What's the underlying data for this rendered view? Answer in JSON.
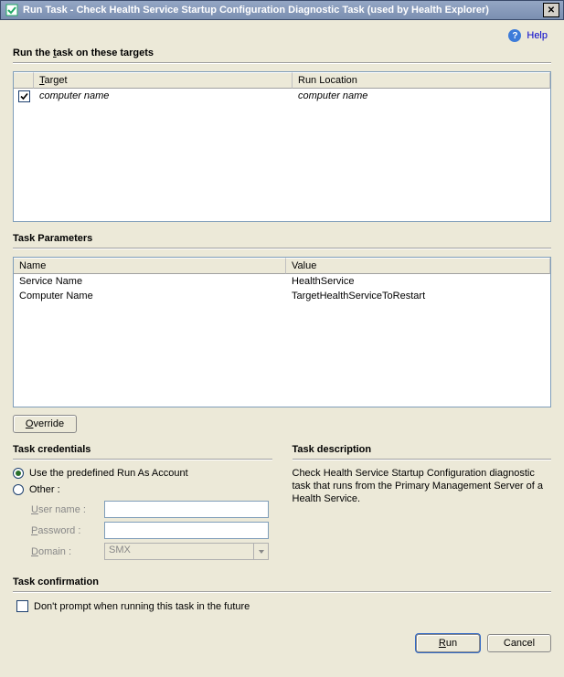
{
  "window": {
    "title": "Run Task - Check Health Service Startup Configuration Diagnostic Task (used by Health Explorer)",
    "close_glyph": "✕"
  },
  "help": {
    "label": "Help",
    "icon_glyph": "?"
  },
  "targets": {
    "section_title": "Run the task on these targets",
    "columns": {
      "target": "Target",
      "run_location": "Run Location"
    },
    "rows": [
      {
        "checked": true,
        "target": "computer name",
        "run_location": "computer name"
      }
    ]
  },
  "params": {
    "section_title": "Task Parameters",
    "columns": {
      "name": "Name",
      "value": "Value"
    },
    "rows": [
      {
        "name": "Service Name",
        "value": "HealthService"
      },
      {
        "name": "Computer Name",
        "value": "TargetHealthServiceToRestart"
      }
    ]
  },
  "override": {
    "label": "Override"
  },
  "credentials": {
    "section_title": "Task credentials",
    "use_predefined_label": "Use the predefined Run As Account",
    "other_label": "Other :",
    "username_label": "User name :",
    "password_label": "Password :",
    "domain_label": "Domain :",
    "domain_value": "SMX",
    "selected": "predefined"
  },
  "description": {
    "section_title": "Task description",
    "text": "Check Health Service Startup Configuration diagnostic task that runs from the Primary Management Server of a Health Service."
  },
  "confirmation": {
    "section_title": "Task confirmation",
    "dont_prompt_label": "Don't prompt when running this task in the future",
    "dont_prompt_checked": false
  },
  "buttons": {
    "run": "Run",
    "cancel": "Cancel"
  }
}
